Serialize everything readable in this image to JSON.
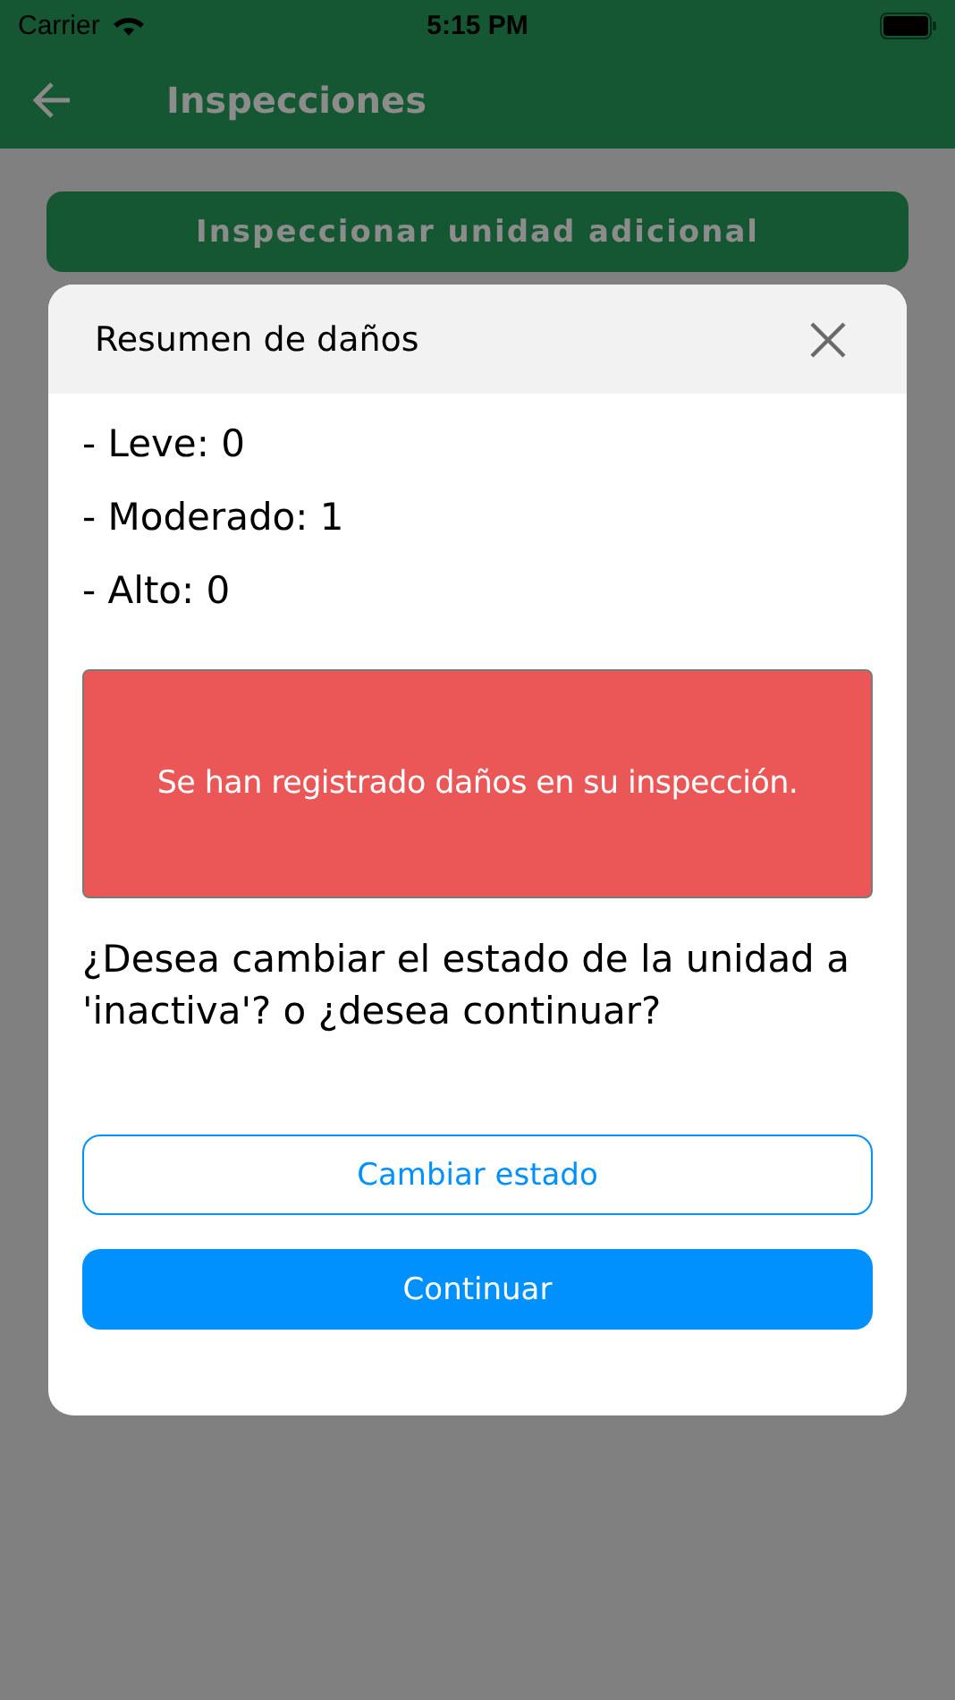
{
  "status_bar": {
    "carrier": "Carrier",
    "time": "5:15 PM"
  },
  "header": {
    "title": "Inspecciones"
  },
  "primary_button": "Inspeccionar unidad adicional",
  "dialog": {
    "title": "Resumen de daños",
    "summary": [
      "- Leve: 0",
      "- Moderado: 1",
      "- Alto: 0"
    ],
    "alert": "Se han registrado daños en su inspección.",
    "question": "¿Desea cambiar el estado de la unidad a 'inactiva'? o ¿desea continuar?",
    "buttons": [
      {
        "label": "Cambiar estado",
        "kind": "outline"
      },
      {
        "label": "Continuar",
        "kind": "filled"
      }
    ]
  }
}
